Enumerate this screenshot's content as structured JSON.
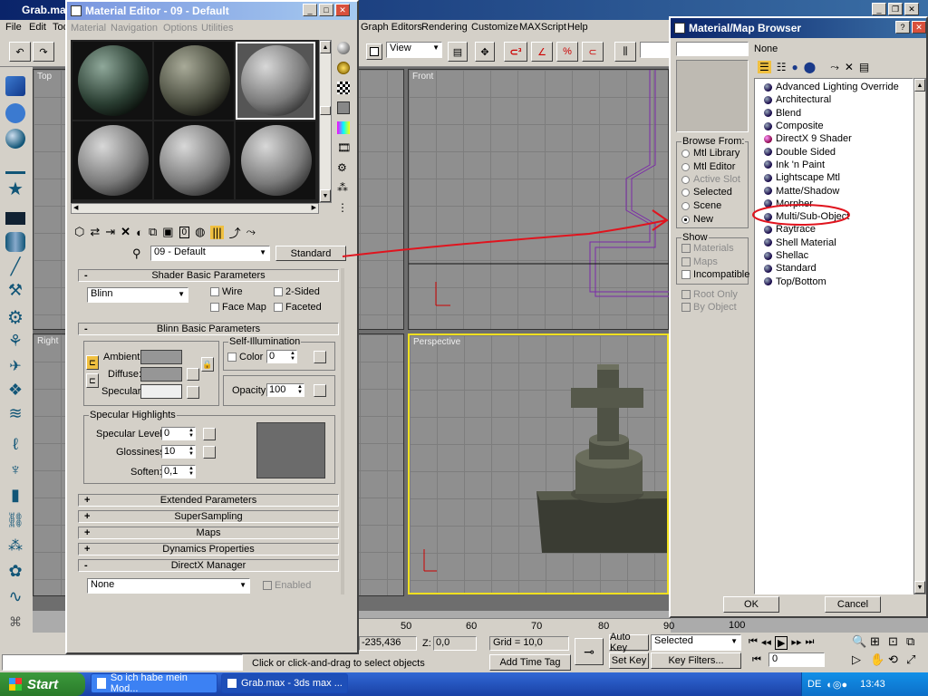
{
  "main": {
    "title": "Grab.max",
    "menu_left": [
      "File",
      "Edit",
      "Too"
    ],
    "menu_right": [
      "Graph Editors",
      "Rendering",
      "Customize",
      "MAXScript",
      "Help"
    ],
    "view_select": "View",
    "viewports": {
      "top": "Top",
      "front": "Front",
      "right": "Right",
      "perspective": "Perspective"
    }
  },
  "status": {
    "coord_y": "-235,436",
    "coord_z_label": "Z:",
    "coord_z": "0,0",
    "grid": "Grid = 10,0",
    "auto_key": "Auto Key",
    "set_key": "Set Key",
    "selected": "Selected",
    "key_filters": "Key Filters...",
    "frame": "0",
    "prompt": "Click or click-and-drag to select objects",
    "add_time_tag": "Add Time Tag",
    "ruler": [
      "50",
      "60",
      "70",
      "80",
      "90",
      "100"
    ]
  },
  "med": {
    "title": "Material Editor - 09 - Default",
    "menu": [
      "Material",
      "Navigation",
      "Options",
      "Utilities"
    ],
    "mat_name": "09 - Default",
    "mat_type": "Standard",
    "shader_rollout": "Shader Basic Parameters",
    "shader": "Blinn",
    "wire": "Wire",
    "two_sided": "2-Sided",
    "face_map": "Face Map",
    "faceted": "Faceted",
    "blinn_rollout": "Blinn Basic Parameters",
    "self_illum": "Self-Illumination",
    "color": "Color",
    "color_val": "0",
    "ambient": "Ambient:",
    "diffuse": "Diffuse:",
    "specular": "Specular:",
    "opacity": "Opacity:",
    "opacity_val": "100",
    "spec_highlights": "Specular Highlights",
    "spec_level": "Specular Level:",
    "spec_level_val": "0",
    "glossiness": "Glossiness:",
    "glossiness_val": "10",
    "soften": "Soften:",
    "soften_val": "0,1",
    "rollouts": [
      {
        "sign": "+",
        "label": "Extended Parameters"
      },
      {
        "sign": "+",
        "label": "SuperSampling"
      },
      {
        "sign": "+",
        "label": "Maps"
      },
      {
        "sign": "+",
        "label": "Dynamics Properties"
      },
      {
        "sign": "-",
        "label": "DirectX Manager"
      }
    ],
    "dx_none": "None",
    "dx_enabled": "Enabled"
  },
  "browser": {
    "title": "Material/Map Browser",
    "header": "None",
    "browse_from": "Browse From:",
    "sources": [
      "Mtl Library",
      "Mtl Editor",
      "Active Slot",
      "Selected",
      "Scene",
      "New"
    ],
    "show": "Show",
    "show_opts": [
      "Materials",
      "Maps",
      "Incompatible"
    ],
    "root_only": "Root Only",
    "by_object": "By Object",
    "items": [
      "Advanced Lighting Override",
      "Architectural",
      "Blend",
      "Composite",
      "DirectX 9 Shader",
      "Double Sided",
      "Ink 'n Paint",
      "Lightscape Mtl",
      "Matte/Shadow",
      "Morpher",
      "Multi/Sub-Object",
      "Raytrace",
      "Shell Material",
      "Shellac",
      "Standard",
      "Top/Bottom"
    ],
    "ok": "OK",
    "cancel": "Cancel"
  },
  "taskbar": {
    "start": "Start",
    "tasks": [
      "So ich habe mein Mod...",
      "Grab.max - 3ds max ..."
    ],
    "lang": "DE",
    "clock": "13:43"
  },
  "colors": {
    "annotation": "#e0141e",
    "titlebar": "#0a246a",
    "selection_yellow": "#f0e020"
  }
}
